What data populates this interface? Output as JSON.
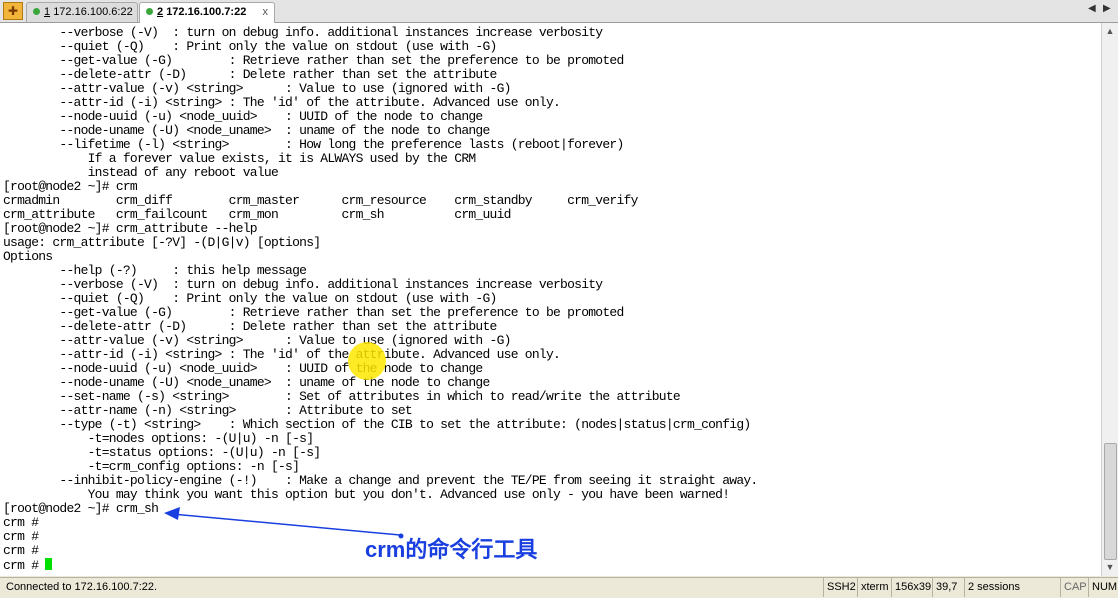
{
  "tabs": [
    {
      "number": "1",
      "label": "172.16.100.6:22",
      "status_color": "#3aa63a"
    },
    {
      "number": "2",
      "label": "172.16.100.7:22",
      "status_color": "#3aa63a",
      "close": "x"
    }
  ],
  "colors": {
    "cursor": "#00e000",
    "annotation": "#1a3fe0",
    "highlight": "#ffe600"
  },
  "terminal_lines": [
    "        --verbose (-V)  : turn on debug info. additional instances increase verbosity",
    "        --quiet (-Q)    : Print only the value on stdout (use with -G)",
    "        --get-value (-G)        : Retrieve rather than set the preference to be promoted",
    "        --delete-attr (-D)      : Delete rather than set the attribute",
    "        --attr-value (-v) <string>      : Value to use (ignored with -G)",
    "        --attr-id (-i) <string> : The 'id' of the attribute. Advanced use only.",
    "        --node-uuid (-u) <node_uuid>    : UUID of the node to change",
    "        --node-uname (-U) <node_uname>  : uname of the node to change",
    "        --lifetime (-l) <string>        : How long the preference lasts (reboot|forever)",
    "            If a forever value exists, it is ALWAYS used by the CRM",
    "            instead of any reboot value",
    "[root@node2 ~]# crm",
    "crmadmin        crm_diff        crm_master      crm_resource    crm_standby     crm_verify",
    "crm_attribute   crm_failcount   crm_mon         crm_sh          crm_uuid",
    "[root@node2 ~]# crm_attribute --help",
    "usage: crm_attribute [-?V] -(D|G|v) [options]",
    "Options",
    "        --help (-?)     : this help message",
    "        --verbose (-V)  : turn on debug info. additional instances increase verbosity",
    "        --quiet (-Q)    : Print only the value on stdout (use with -G)",
    "        --get-value (-G)        : Retrieve rather than set the preference to be promoted",
    "        --delete-attr (-D)      : Delete rather than set the attribute",
    "        --attr-value (-v) <string>      : Value to use (ignored with -G)",
    "        --attr-id (-i) <string> : The 'id' of the attribute. Advanced use only.",
    "        --node-uuid (-u) <node_uuid>    : UUID of the node to change",
    "        --node-uname (-U) <node_uname>  : uname of the node to change",
    "        --set-name (-s) <string>        : Set of attributes in which to read/write the attribute",
    "        --attr-name (-n) <string>       : Attribute to set",
    "        --type (-t) <string>    : Which section of the CIB to set the attribute: (nodes|status|crm_config)",
    "            -t=nodes options: -(U|u) -n [-s]",
    "            -t=status options: -(U|u) -n [-s]",
    "            -t=crm_config options: -n [-s]",
    "        --inhibit-policy-engine (-!)    : Make a change and prevent the TE/PE from seeing it straight away.",
    "            You may think you want this option but you don't. Advanced use only - you have been warned!",
    "[root@node2 ~]# crm_sh",
    "crm #",
    "crm #",
    "crm #",
    "crm # "
  ],
  "annotation": {
    "text": "crm的命令行工具"
  },
  "statusbar": {
    "connection": "Connected to 172.16.100.7:22.",
    "protocol": "SSH2",
    "terminal_type": "xterm",
    "size": "156x39",
    "cursor_pos": "39,7",
    "sessions": "2 sessions",
    "cap": "CAP",
    "num": "NUM"
  }
}
